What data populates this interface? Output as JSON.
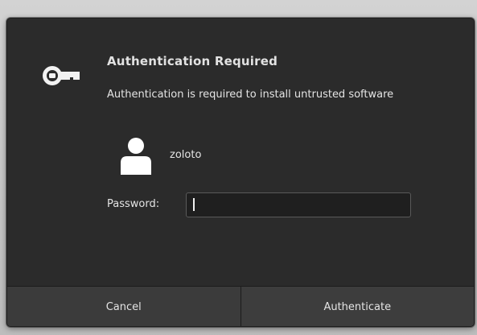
{
  "dialog": {
    "title": "Authentication Required",
    "message": "Authentication is required to install untrusted software",
    "icon": "key-icon"
  },
  "user": {
    "name": "zoloto",
    "avatar_icon": "user-avatar-icon"
  },
  "password": {
    "label": "Password:",
    "value": "",
    "placeholder": ""
  },
  "buttons": {
    "cancel": "Cancel",
    "authenticate": "Authenticate"
  },
  "colors": {
    "dialog_bg": "#2b2b2b",
    "text": "#e4e4e4",
    "button_bg": "#3b3b3b",
    "input_bg": "#1f1f1f"
  }
}
